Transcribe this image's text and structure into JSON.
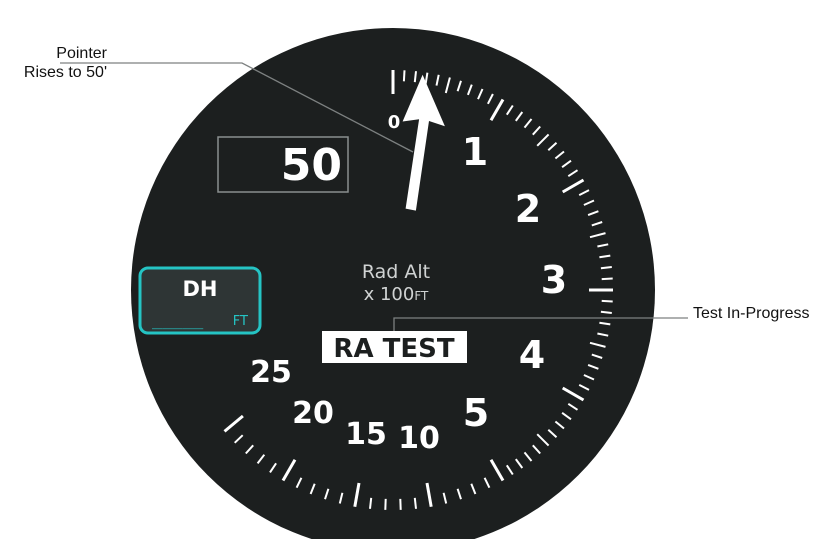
{
  "callouts": {
    "pointer_line1": "Pointer",
    "pointer_line2": "Rises to 50'",
    "test": "Test In-Progress"
  },
  "display": {
    "altitude_value": "50",
    "title_line1": "Rad Alt",
    "title_line2_main": "x 100",
    "title_line2_unit": "FT",
    "test_annunciation": "RA TEST"
  },
  "dh_button": {
    "label": "DH",
    "value": "_____",
    "unit": "FT"
  },
  "scale": {
    "labels": [
      "0",
      "1",
      "2",
      "3",
      "4",
      "5",
      "10",
      "15",
      "20",
      "25"
    ],
    "pointer_reading_ft": 50
  },
  "colors": {
    "face": "#1c1f1f",
    "markings": "#ffffff",
    "dh_accent": "#25c4c4",
    "dh_button": "#2e3535"
  },
  "icons": {
    "pointer": "needle-arrow-icon"
  }
}
